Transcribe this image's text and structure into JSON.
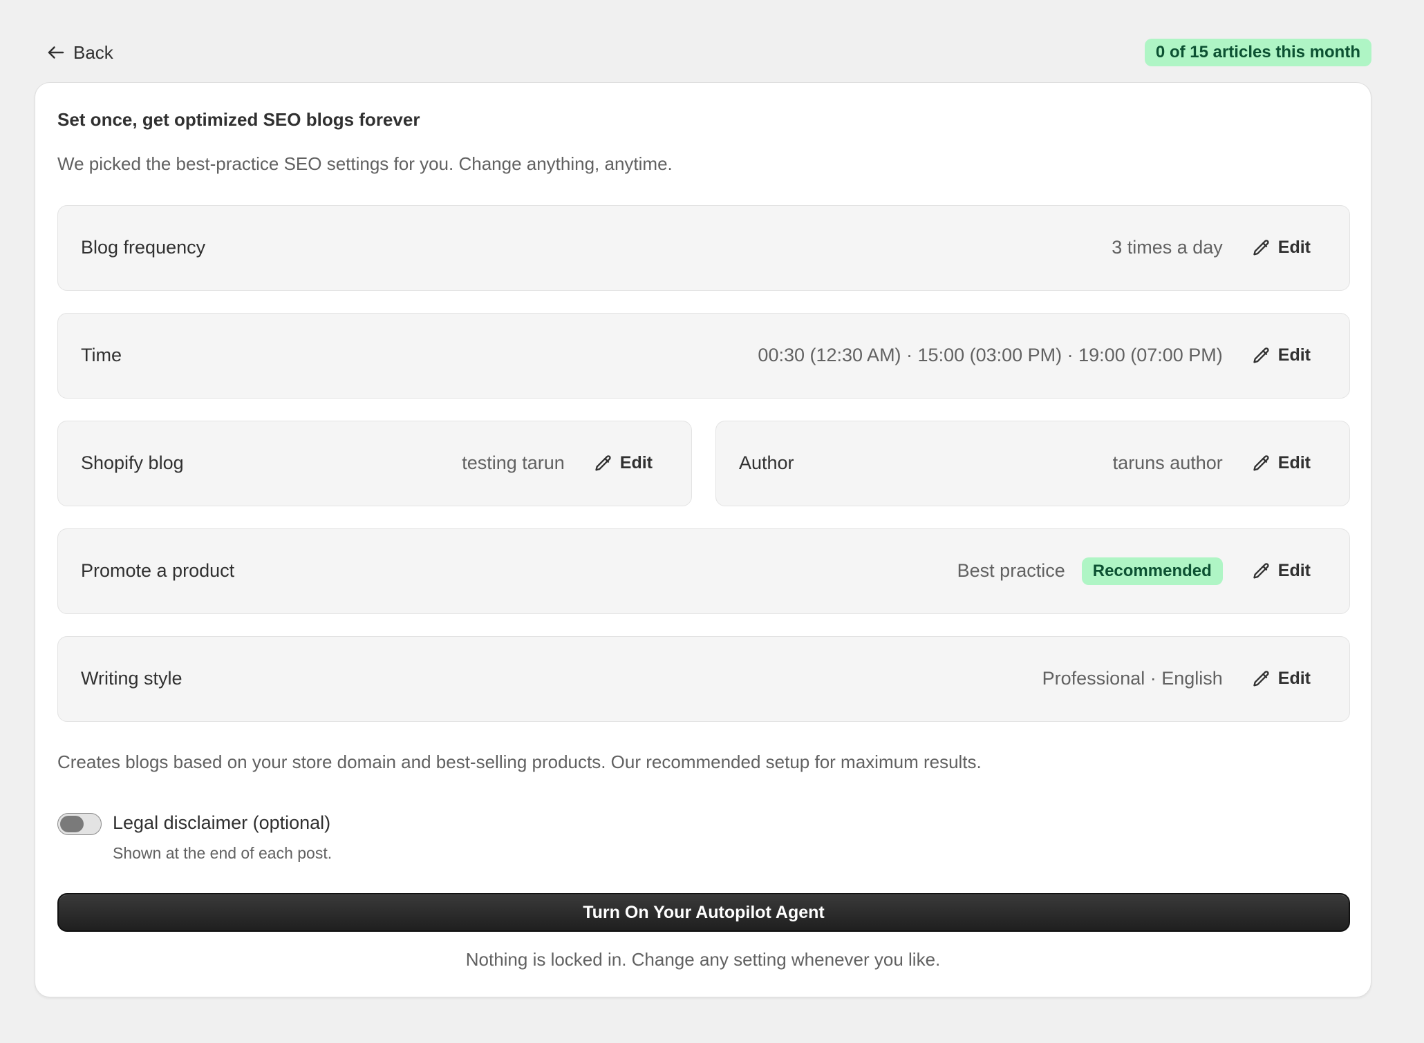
{
  "header": {
    "back_label": "Back",
    "quota_badge": "0 of 15 articles this month"
  },
  "card": {
    "title": "Set once, get optimized SEO blogs forever",
    "subtitle": "We picked the best-practice SEO settings for you. Change anything, anytime."
  },
  "settings": {
    "blog_frequency": {
      "label": "Blog frequency",
      "value": "3 times a day",
      "edit": "Edit"
    },
    "time": {
      "label": "Time",
      "value": "00:30 (12:30 AM) · 15:00 (03:00 PM) · 19:00 (07:00 PM)",
      "edit": "Edit"
    },
    "shopify_blog": {
      "label": "Shopify blog",
      "value": "testing tarun",
      "edit": "Edit"
    },
    "author": {
      "label": "Author",
      "value": "taruns author",
      "edit": "Edit"
    },
    "promote_product": {
      "label": "Promote a product",
      "value": "Best practice",
      "badge": "Recommended",
      "edit": "Edit"
    },
    "writing_style": {
      "label": "Writing style",
      "value": "Professional · English",
      "edit": "Edit"
    }
  },
  "note": "Creates blogs based on your store domain and best-selling products. Our recommended setup for maximum results.",
  "disclaimer": {
    "label": "Legal disclaimer (optional)",
    "help": "Shown at the end of each post.",
    "enabled": false
  },
  "primary_button": "Turn On Your Autopilot Agent",
  "footer_note": "Nothing is locked in. Change any setting whenever you like.",
  "icons": {
    "back": "arrow-left-icon",
    "edit": "pencil-icon"
  },
  "colors": {
    "badge_bg": "#aff5c5",
    "badge_text": "#0c5132",
    "primary_bg": "#303030"
  }
}
